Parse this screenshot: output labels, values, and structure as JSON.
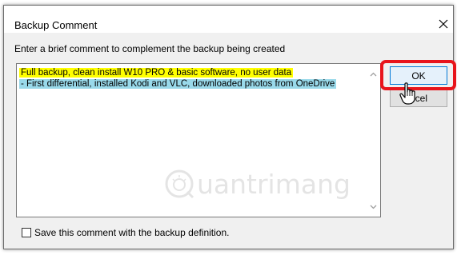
{
  "dialog": {
    "title": "Backup Comment",
    "close_icon": "close-icon"
  },
  "prompt": "Enter a brief comment to complement the backup being created",
  "comment": {
    "lines": [
      "Full backup, clean install W10 PRO & basic software, no user data",
      " - First differential, installed Kodi and VLC, downloaded photos from OneDrive"
    ],
    "highlight_colors": [
      "#ffff00",
      "#99d9ea"
    ]
  },
  "buttons": {
    "ok_label": "OK",
    "cancel_label": "ncel"
  },
  "checkbox": {
    "label": "Save this comment with the backup definition.",
    "checked": false
  },
  "watermark": {
    "text": "uantrimang"
  },
  "colors": {
    "annotation_red": "#e8141b",
    "ok_border": "#0078d7"
  }
}
